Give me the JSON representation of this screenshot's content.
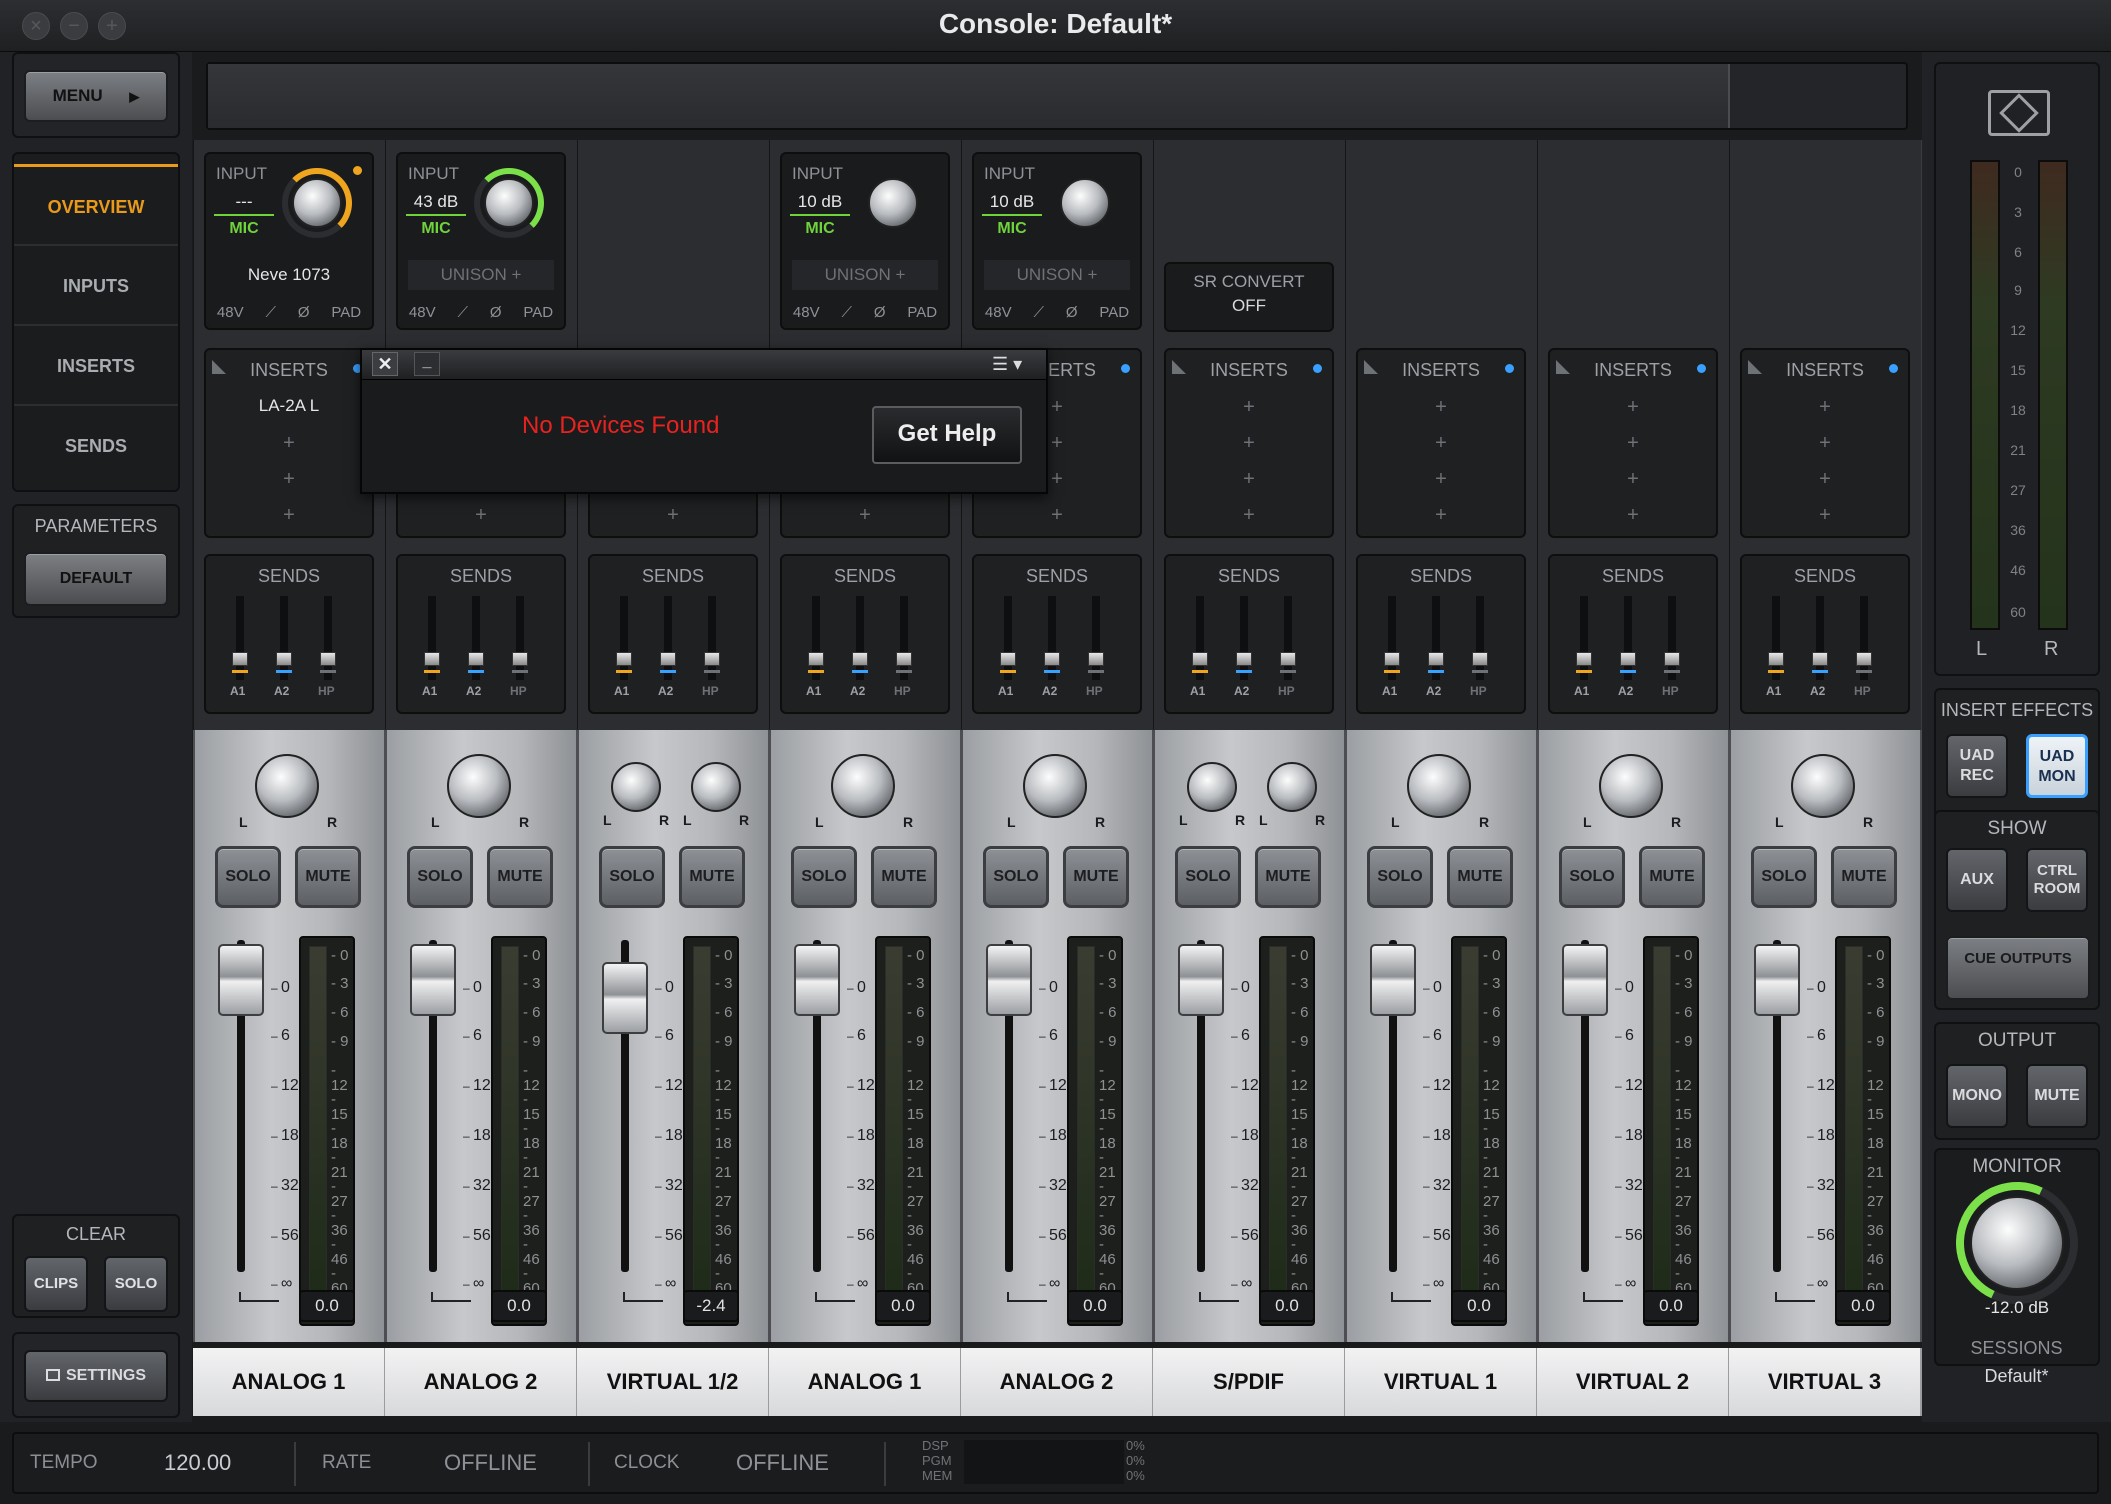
{
  "window": {
    "title": "Console: Default*",
    "close_glyph": "×",
    "min_glyph": "−",
    "max_glyph": "+"
  },
  "left": {
    "menu_label": "MENU",
    "nav": [
      "OVERVIEW",
      "INPUTS",
      "INSERTS",
      "SENDS"
    ],
    "parameters_label": "PARAMETERS",
    "default_label": "DEFAULT",
    "clear_label": "CLEAR",
    "clips_label": "CLIPS",
    "solo_label": "SOLO",
    "settings_label": "SETTINGS"
  },
  "dialog": {
    "close": "✕",
    "minimize": "_",
    "message": "No Devices Found",
    "button": "Get Help"
  },
  "labels": {
    "input": "INPUT",
    "mic": "MIC",
    "inserts": "INSERTS",
    "sends": "SENDS",
    "solo": "SOLO",
    "mute": "MUTE",
    "l": "L",
    "r": "R",
    "p48": "48V",
    "phase": "Ø",
    "pad": "PAD",
    "hpf": "⟋",
    "a1": "A1",
    "a2": "A2",
    "hp": "HP",
    "plus": "+"
  },
  "sr_convert": {
    "title": "SR CONVERT",
    "value": "OFF"
  },
  "channels": [
    {
      "name": "ANALOG 1",
      "input": {
        "gain": "---",
        "type": "MIC",
        "unison": "Neve 1073"
      },
      "inserts": [
        "LA-2A L",
        "+",
        "+",
        "+"
      ],
      "level": "0.0"
    },
    {
      "name": "ANALOG 2",
      "input": {
        "gain": "43 dB",
        "type": "MIC",
        "unison": "UNISON +"
      },
      "inserts": [
        "+",
        "+",
        "+",
        "+"
      ],
      "level": "0.0"
    },
    {
      "name": "VIRTUAL 1/2",
      "input": null,
      "inserts": [
        "+",
        "+",
        "+",
        "+"
      ],
      "level": "-2.4"
    },
    {
      "name": "ANALOG 1",
      "input": {
        "gain": "10 dB",
        "type": "MIC",
        "unison": "UNISON +"
      },
      "inserts": [
        "+",
        "+",
        "+",
        "+"
      ],
      "level": "0.0"
    },
    {
      "name": "ANALOG 2",
      "input": {
        "gain": "10 dB",
        "type": "MIC",
        "unison": "UNISON +"
      },
      "inserts": [
        "+",
        "+",
        "+",
        "+"
      ],
      "level": "0.0"
    },
    {
      "name": "S/PDIF",
      "input": null,
      "inserts": [
        "+",
        "+",
        "+",
        "+"
      ],
      "level": "0.0"
    },
    {
      "name": "VIRTUAL 1",
      "input": null,
      "inserts": [
        "+",
        "+",
        "+",
        "+"
      ],
      "level": "0.0"
    },
    {
      "name": "VIRTUAL 2",
      "input": null,
      "inserts": [
        "+",
        "+",
        "+",
        "+"
      ],
      "level": "0.0"
    },
    {
      "name": "VIRTUAL 3",
      "input": null,
      "inserts": [
        "+",
        "+",
        "+",
        "+"
      ],
      "level": "0.0"
    }
  ],
  "fader_scale": [
    "0",
    "6",
    "12",
    "18",
    "32",
    "56",
    "∞"
  ],
  "meter_scale": [
    "0",
    "3",
    "6",
    "9",
    "12",
    "15",
    "18",
    "21",
    "27",
    "36",
    "46",
    "60"
  ],
  "right": {
    "insert_effects": "INSERT EFFECTS",
    "uad_rec": "UAD REC",
    "uad_mon": "UAD MON",
    "show": "SHOW",
    "aux": "AUX",
    "ctrl_room": "CTRL ROOM",
    "cue_outputs": "CUE OUTPUTS",
    "output": "OUTPUT",
    "mono": "MONO",
    "mute": "MUTE",
    "monitor": "MONITOR",
    "monitor_value": "-12.0 dB",
    "sessions": "SESSIONS",
    "session_name": "Default*",
    "meter_l": "L",
    "meter_r": "R"
  },
  "status": {
    "tempo_label": "TEMPO",
    "tempo_value": "120.00",
    "rate_label": "RATE",
    "rate_value": "OFFLINE",
    "clock_label": "CLOCK",
    "clock_value": "OFFLINE",
    "dsp": "DSP",
    "pgm": "PGM",
    "mem": "MEM",
    "dsp_val": "0%",
    "pgm_val": "0%",
    "mem_val": "0%"
  },
  "colors": {
    "accent": "#ea9a1a",
    "mic_green": "#6fd43a",
    "error_red": "#e8231f",
    "uad_blue": "#3aa0ff"
  }
}
